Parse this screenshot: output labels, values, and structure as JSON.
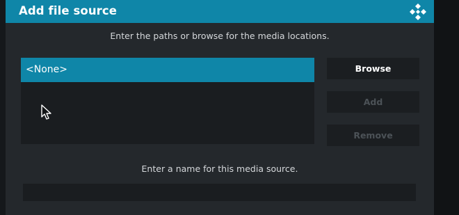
{
  "dialog": {
    "title": "Add file source",
    "paths_instruction": "Enter the paths or browse for the media locations.",
    "name_instruction": "Enter a name for this media source.",
    "name_value": ""
  },
  "paths": {
    "items": [
      "<None>"
    ]
  },
  "buttons": {
    "browse": "Browse",
    "add": "Add",
    "remove": "Remove"
  },
  "icons": {
    "logo": "kodi-logo-icon",
    "pointer": "mouse-pointer-icon"
  },
  "colors": {
    "accent": "#0f86a8",
    "dialog_bg": "#24282c",
    "panel_bg": "#1a1d20",
    "disabled_text": "#4c5257"
  }
}
